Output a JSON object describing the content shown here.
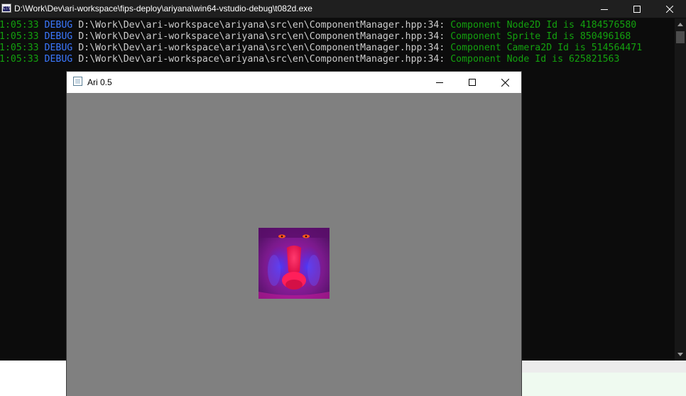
{
  "console": {
    "title": "D:\\Work\\Dev\\ari-workspace\\fips-deploy\\ariyana\\win64-vstudio-debug\\t082d.exe",
    "icon": "console-icon",
    "icon_text": "C:\\",
    "lines": [
      {
        "time": "1:05:33",
        "level": "DEBUG",
        "path": "D:\\Work\\Dev\\ari-workspace\\ariyana\\src\\en\\ComponentManager.hpp:34:",
        "message": "Component Node2D Id is 4184576580"
      },
      {
        "time": "1:05:33",
        "level": "DEBUG",
        "path": "D:\\Work\\Dev\\ari-workspace\\ariyana\\src\\en\\ComponentManager.hpp:34:",
        "message": "Component Sprite Id is 850496168"
      },
      {
        "time": "1:05:33",
        "level": "DEBUG",
        "path": "D:\\Work\\Dev\\ari-workspace\\ariyana\\src\\en\\ComponentManager.hpp:34:",
        "message": "Component Camera2D Id is 514564471"
      },
      {
        "time": "1:05:33",
        "level": "DEBUG",
        "path": "D:\\Work\\Dev\\ari-workspace\\ariyana\\src\\en\\ComponentManager.hpp:34:",
        "message": "Component Node Id is 625821563"
      }
    ],
    "colors": {
      "background": "#0c0c0c",
      "titlebar": "#1f1f1f",
      "time": "#13a10e",
      "level": "#3b78ff",
      "path": "#cccccc",
      "message": "#13a10e"
    }
  },
  "app": {
    "title": "Ari 0.5",
    "icon": "app-window-icon",
    "canvas_color": "#808080",
    "sprite": {
      "description_icon": "mandrill-sprite-image",
      "colors": [
        "#7a1a8c",
        "#3b2bd8",
        "#ff1f5a",
        "#d01fc8"
      ]
    }
  },
  "caption_buttons": {
    "minimize_icon": "minimize-icon",
    "maximize_icon": "maximize-icon",
    "close_icon": "close-icon"
  }
}
